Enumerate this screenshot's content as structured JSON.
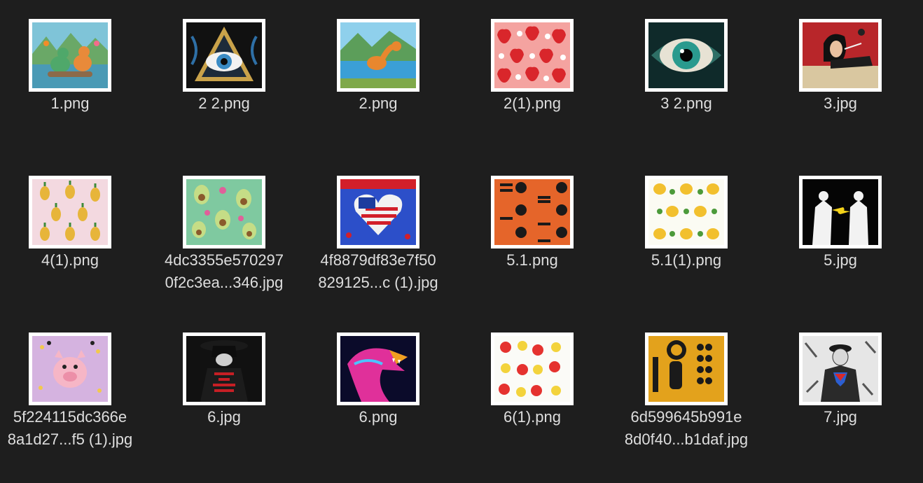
{
  "files": [
    {
      "name": "1.png",
      "icon": "dinosaur-thumbnail"
    },
    {
      "name": "2 2.png",
      "icon": "eye-triangle-thumbnail"
    },
    {
      "name": "2.png",
      "icon": "dinosaur-lake-thumbnail"
    },
    {
      "name": "2(1).png",
      "icon": "strawberry-pattern-thumbnail"
    },
    {
      "name": "3 2.png",
      "icon": "eye-closeup-thumbnail"
    },
    {
      "name": "3.jpg",
      "icon": "woman-poster-thumbnail"
    },
    {
      "name": "4(1).png",
      "icon": "pineapple-pattern-thumbnail"
    },
    {
      "name": "4dc3355e570297\n0f2c3ea...346.jpg",
      "icon": "avocado-pattern-thumbnail"
    },
    {
      "name": "4f8879df83e7f50\n829125...c (1).jpg",
      "icon": "flag-heart-thumbnail"
    },
    {
      "name": "5.1.png",
      "icon": "halloween-pattern-thumbnail"
    },
    {
      "name": "5.1(1).png",
      "icon": "mango-pattern-thumbnail"
    },
    {
      "name": "5.jpg",
      "icon": "two-figures-thumbnail"
    },
    {
      "name": "5f224115dc366e\n8a1d27...f5 (1).jpg",
      "icon": "pig-thumbnail"
    },
    {
      "name": "6.jpg",
      "icon": "hooded-figure-thumbnail"
    },
    {
      "name": "6.png",
      "icon": "neon-dinosaur-thumbnail"
    },
    {
      "name": "6(1).png",
      "icon": "apple-pattern-thumbnail"
    },
    {
      "name": "6d599645b991e\n8d0f40...b1daf.jpg",
      "icon": "coffee-logo-thumbnail"
    },
    {
      "name": "7.jpg",
      "icon": "superhero-sketch-thumbnail"
    }
  ],
  "colors": {
    "background": "#1e1e1e",
    "label": "#dedede",
    "thumbnail_border": "#ffffff"
  }
}
